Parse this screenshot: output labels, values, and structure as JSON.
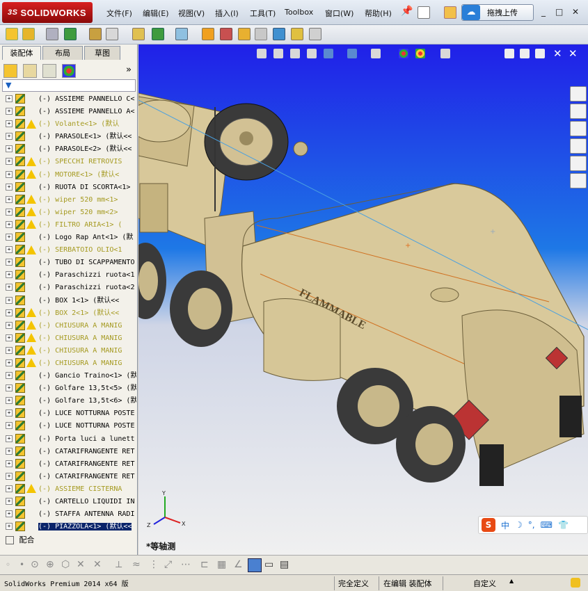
{
  "app": {
    "logo_ds": "3S",
    "logo_text": "SOLIDWORKS",
    "menus": [
      "文件(F)",
      "编辑(E)",
      "视图(V)",
      "插入(I)",
      "工具(T)",
      "Toolbox",
      "窗口(W)",
      "帮助(H)"
    ],
    "upload_label": "拖拽上传",
    "window_controls": [
      "_",
      "□",
      "✕"
    ]
  },
  "left_panel": {
    "tabs": [
      "装配体",
      "布局",
      "草图"
    ],
    "tree": [
      {
        "label": "(-) ASSIEME PANNELLO C<",
        "warn": false,
        "suppressed": false
      },
      {
        "label": "(-) ASSIEME PANNELLO A<",
        "warn": false,
        "suppressed": false
      },
      {
        "label": "(-) Volante<1> (默认",
        "warn": true,
        "suppressed": true
      },
      {
        "label": "(-) PARASOLE<1> (默认<<",
        "warn": false,
        "suppressed": false
      },
      {
        "label": "(-) PARASOLE<2> (默认<<",
        "warn": false,
        "suppressed": false
      },
      {
        "label": "(-) SPECCHI RETROVIS",
        "warn": true,
        "suppressed": true
      },
      {
        "label": "(-) MOTORE<1> (默认<",
        "warn": true,
        "suppressed": true
      },
      {
        "label": "(-) RUOTA DI SCORTA<1>",
        "warn": false,
        "suppressed": false
      },
      {
        "label": "(-) wiper 520 mm<1>",
        "warn": true,
        "suppressed": true
      },
      {
        "label": "(-) wiper 520 mm<2>",
        "warn": true,
        "suppressed": true
      },
      {
        "label": "(-) FILTRO ARIA<1> (",
        "warn": true,
        "suppressed": true
      },
      {
        "label": "(-) Logo Rap Ant<1> (默",
        "warn": false,
        "suppressed": false
      },
      {
        "label": "(-) SERBATOIO OLIO<1",
        "warn": true,
        "suppressed": true
      },
      {
        "label": "(-) TUBO DI SCAPPAMENTO",
        "warn": false,
        "suppressed": false
      },
      {
        "label": "(-) Paraschizzi ruota<1",
        "warn": false,
        "suppressed": false
      },
      {
        "label": "(-) Paraschizzi ruota<2",
        "warn": false,
        "suppressed": false
      },
      {
        "label": "(-) BOX 1<1> (默认<<",
        "warn": false,
        "suppressed": false
      },
      {
        "label": "(-) BOX 2<1> (默认<<",
        "warn": true,
        "suppressed": true
      },
      {
        "label": "(-) CHIUSURA A MANIG",
        "warn": true,
        "suppressed": true
      },
      {
        "label": "(-) CHIUSURA A MANIG",
        "warn": true,
        "suppressed": true
      },
      {
        "label": "(-) CHIUSURA A MANIG",
        "warn": true,
        "suppressed": true
      },
      {
        "label": "(-) CHIUSURA A MANIG",
        "warn": true,
        "suppressed": true
      },
      {
        "label": "(-) Gancio Traino<1> (默",
        "warn": false,
        "suppressed": false
      },
      {
        "label": "(-) Golfare 13,5t<5> (默",
        "warn": false,
        "suppressed": false
      },
      {
        "label": "(-) Golfare 13,5t<6> (默",
        "warn": false,
        "suppressed": false
      },
      {
        "label": "(-) LUCE NOTTURNA POSTE",
        "warn": false,
        "suppressed": false
      },
      {
        "label": "(-) LUCE NOTTURNA POSTE",
        "warn": false,
        "suppressed": false
      },
      {
        "label": "(-) Porta luci a lunett",
        "warn": false,
        "suppressed": false
      },
      {
        "label": "(-) CATARIFRANGENTE RET",
        "warn": false,
        "suppressed": false
      },
      {
        "label": "(-) CATARIFRANGENTE RET",
        "warn": false,
        "suppressed": false
      },
      {
        "label": "(-) CATARIFRANGENTE RET",
        "warn": false,
        "suppressed": false
      },
      {
        "label": "(-) ASSIEME CISTERNA",
        "warn": true,
        "suppressed": true
      },
      {
        "label": "(-) CARTELLO LIQUIDI IN",
        "warn": false,
        "suppressed": false
      },
      {
        "label": "(-) STAFFA ANTENNA RADI",
        "warn": false,
        "suppressed": false
      },
      {
        "label": "(-) PIAZZOLA<1> (默认<<",
        "warn": false,
        "suppressed": false,
        "selected": true
      }
    ],
    "mates_label": "配合"
  },
  "viewport": {
    "view_label": "*等轴测",
    "tank_text": "FLAMMABLE",
    "ime": [
      "中",
      "☽",
      "°,",
      "⌨",
      "👕"
    ]
  },
  "status": {
    "app_version": "SolidWorks Premium 2014 x64 版",
    "definition": "完全定义",
    "mode": "在编辑 装配体",
    "units": "自定义"
  },
  "colors": {
    "truck_body": "#d8c89a",
    "tire": "#3a3a3a",
    "selection": "#0a246a",
    "suppressed_text": "#a59a20"
  }
}
